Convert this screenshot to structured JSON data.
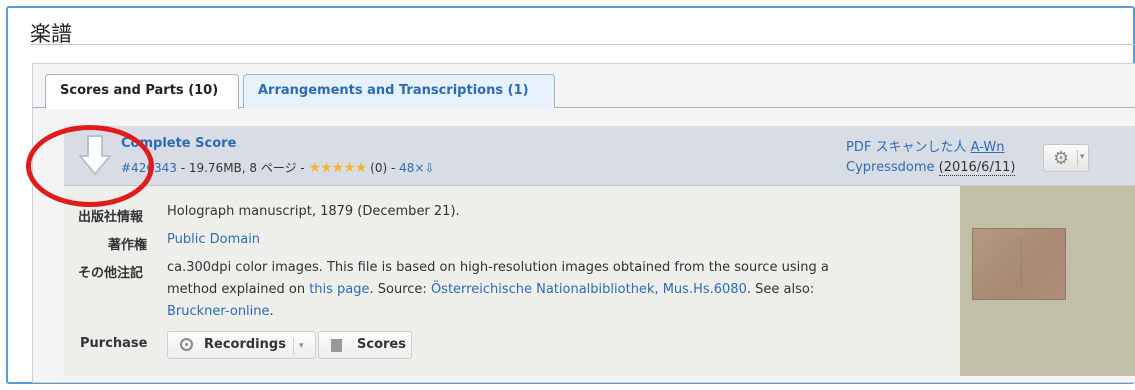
{
  "section": {
    "title": "楽譜"
  },
  "tabs": [
    {
      "label": "Scores and Parts (10)",
      "active": true
    },
    {
      "label": "Arrangements and Transcriptions (1)",
      "active": false
    }
  ],
  "file": {
    "title": "Complete Score",
    "id": "#426343",
    "meta_text": " - 19.76MB, 8 ページ - ",
    "rating_count": " (0) - ",
    "downloads": "48×⇩",
    "scan_type": "PDF スキャンした人 ",
    "scanner_1": "A-Wn",
    "scanner_2": "Cypressdome",
    "date": "(2016/6/11)"
  },
  "info": {
    "publisher_label": "出版社情報",
    "publisher_value": "Holograph manuscript, 1879 (December 21).",
    "copyright_label": "著作権",
    "copyright_value": "Public Domain",
    "notes_label": "その他注記",
    "notes_line1": "ca.300dpi color images. This file is based on high-resolution images obtained from the source using a",
    "notes_line2_a": "method explained on ",
    "notes_link1": "this page",
    "notes_line2_b": ". Source: ",
    "notes_link2": "Österreichische Nationalbibliothek, Mus.Hs.6080",
    "notes_line2_c": ". See also:",
    "notes_link3": "Bruckner-online",
    "notes_line3_end": ".",
    "purchase_label": "Purchase",
    "recordings_label": "Recordings",
    "scores_label": "Scores"
  },
  "colors": {
    "link": "#2d6cb5",
    "highlight": "#e01b1b",
    "tab_inactive_bg": "#e6f1fb"
  }
}
